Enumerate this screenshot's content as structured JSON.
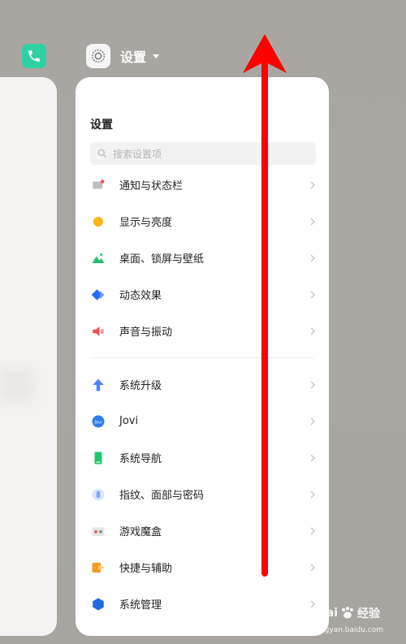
{
  "header": {
    "app_title": "设置"
  },
  "settings": {
    "title": "设置",
    "search_placeholder": "搜索设置项",
    "group1": [
      {
        "label": "通知与状态栏",
        "icon": "notification-icon",
        "color": "#c0c0c0"
      },
      {
        "label": "显示与亮度",
        "icon": "brightness-icon",
        "color": "#f5b51c"
      },
      {
        "label": "桌面、锁屏与壁纸",
        "icon": "wallpaper-icon",
        "color": "#1fbf6f"
      },
      {
        "label": "动态效果",
        "icon": "motion-effect-icon",
        "color": "#2a6cf0"
      },
      {
        "label": "声音与振动",
        "icon": "speaker-icon",
        "color": "#f24d4d"
      }
    ],
    "group2": [
      {
        "label": "系统升级",
        "icon": "upgrade-arrow-icon",
        "color": "#4a86f7"
      },
      {
        "label": "Jovi",
        "icon": "jovi-icon",
        "color": "#2c7df0"
      },
      {
        "label": "系统导航",
        "icon": "navigation-icon",
        "color": "#1ec96b"
      },
      {
        "label": "指纹、面部与密码",
        "icon": "fingerprint-icon",
        "color": "#7fa8f5"
      },
      {
        "label": "游戏魔盒",
        "icon": "game-box-icon",
        "color": "#e25a5a"
      },
      {
        "label": "快捷与辅助",
        "icon": "shortcut-icon",
        "color": "#f59a22"
      },
      {
        "label": "系统管理",
        "icon": "system-management-icon",
        "color": "#1f6be0"
      }
    ]
  },
  "watermark": {
    "brand": "Bai",
    "brand2": "经验",
    "sub": "jingyan.baidu.com"
  },
  "colors": {
    "arrow": "#ff0000",
    "phone": "#2fd1a3"
  }
}
